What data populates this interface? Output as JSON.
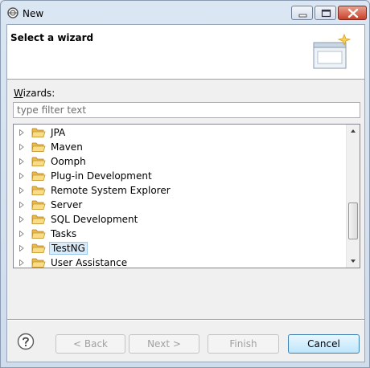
{
  "window": {
    "title": "New",
    "controls": {
      "minimize_icon": "minimize-icon",
      "maximize_icon": "maximize-icon",
      "close_icon": "close-icon"
    }
  },
  "header": {
    "title": "Select a wizard",
    "image": "new-wizard-banner-icon"
  },
  "wizards": {
    "label": "Wizards:",
    "filter_placeholder": "type filter text",
    "filter_value": ""
  },
  "tree": {
    "items": [
      {
        "label": "JPA",
        "icon": "folder-icon",
        "selected": false
      },
      {
        "label": "Maven",
        "icon": "folder-icon",
        "selected": false
      },
      {
        "label": "Oomph",
        "icon": "folder-icon",
        "selected": false
      },
      {
        "label": "Plug-in Development",
        "icon": "folder-icon",
        "selected": false
      },
      {
        "label": "Remote System Explorer",
        "icon": "folder-icon",
        "selected": false
      },
      {
        "label": "Server",
        "icon": "folder-icon",
        "selected": false
      },
      {
        "label": "SQL Development",
        "icon": "folder-icon",
        "selected": false
      },
      {
        "label": "Tasks",
        "icon": "folder-icon",
        "selected": false
      },
      {
        "label": "TestNG",
        "icon": "folder-icon",
        "selected": true
      },
      {
        "label": "User Assistance",
        "icon": "folder-icon",
        "selected": false
      }
    ],
    "scroll_position": 0.82
  },
  "buttons": {
    "help_icon": "help-icon",
    "back_label": "< Back",
    "next_label": "Next >",
    "finish_label": "Finish",
    "cancel_label": "Cancel"
  },
  "colors": {
    "selection_bg": "#d9ebf9",
    "selection_border": "#99c9ef",
    "close_button": "#c9412a"
  }
}
